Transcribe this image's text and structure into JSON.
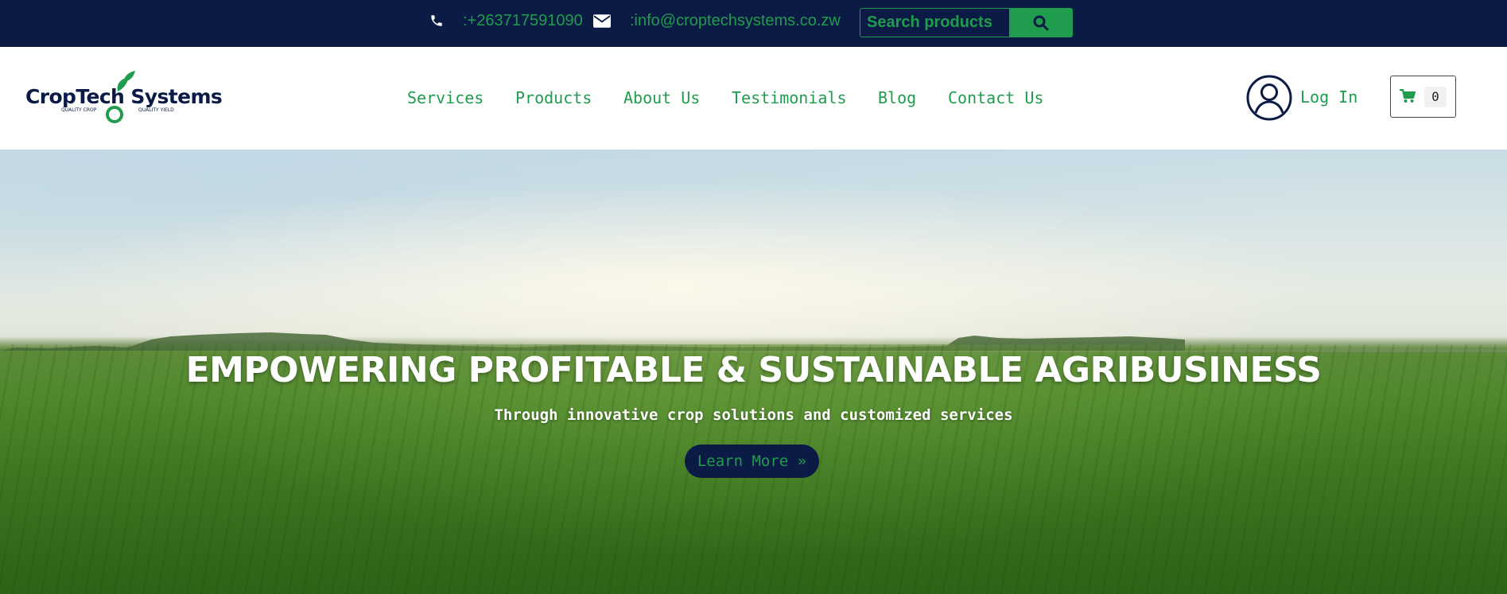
{
  "topbar": {
    "phone": ":+263717591090",
    "email": ":info@croptechsystems.co.zw",
    "search_placeholder": "Search products",
    "icons": {
      "phone": "phone-icon",
      "mail": "envelope-icon",
      "search": "search-icon"
    }
  },
  "brand": {
    "name": "CropTech Systems",
    "tagline_left": "QUALITY CROP",
    "tagline_right": "QUALITY YIELD"
  },
  "nav": {
    "items": [
      {
        "label": "Services"
      },
      {
        "label": "Products"
      },
      {
        "label": "About Us"
      },
      {
        "label": "Testimonials"
      },
      {
        "label": "Blog"
      },
      {
        "label": "Contact Us"
      }
    ],
    "login_label": "Log In",
    "cart_count": "0",
    "icons": {
      "login": "user-circle-icon",
      "cart": "cart-icon"
    }
  },
  "hero": {
    "title": "EMPOWERING PROFITABLE & SUSTAINABLE AGRIBUSINESS",
    "subtitle": "Through innovative crop solutions and customized services",
    "cta_label": "Learn More »"
  },
  "colors": {
    "navy": "#0b1b45",
    "green": "#1f9c4d",
    "white": "#ffffff"
  }
}
